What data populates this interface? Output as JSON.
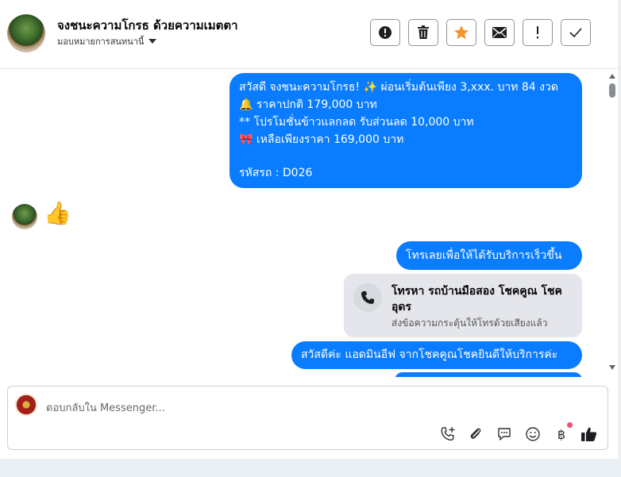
{
  "header": {
    "title": "จงชนะความโกรธ ด้วยความเมตตา",
    "assignee_label": "มอบหมายการสนทนานี้",
    "actions": [
      "spam",
      "delete",
      "star",
      "mark-unread",
      "important",
      "done"
    ]
  },
  "messages": {
    "msg1_lines": [
      "สวัสดี จงชนะความโกรธ! ✨  ผ่อนเริ่มต้นเพียง 3,xxx. บาท 84 งวด",
      "🔔 ราคาปกติ 179,000 บาท",
      "** โปรโมชั่นข้าวแลกลด รับส่วนลด 10,000 บาท",
      "🎀  เหลือเพียงราคา 169,000 บาท",
      "",
      " รหัสรถ : D026"
    ],
    "reaction_emoji": "👍",
    "msg2": "โทรเลยเพื่อให้ได้รับบริการเร็วขึ้น",
    "call_card": {
      "title": "โทรหา รถบ้านมือสอง โชคคูณ โชคอุดร",
      "subtitle": "ส่งข้อความกระตุ้นให้โทรด้วยเสียงแล้ว"
    },
    "msg4": "สวัสดีค่ะ แอดมินอีฟ จากโชคคูณโชคยินดีให้บริการค่ะ"
  },
  "composer": {
    "placeholder": "ตอบกลับใน Messenger...",
    "baht_symbol": "฿",
    "tools": [
      "add-call-icon",
      "attachment-icon",
      "saved-replies-icon",
      "emoji-icon",
      "payment-icon",
      "like-icon"
    ]
  },
  "colors": {
    "accent": "#0a7cff",
    "star": "#f5922b",
    "notification": "#f0506e"
  }
}
